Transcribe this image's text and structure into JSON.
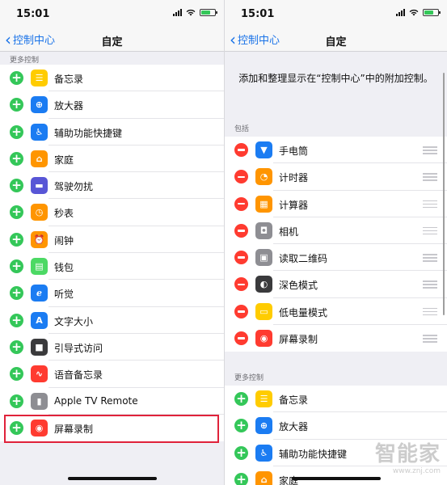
{
  "left": {
    "status": {
      "time": "15:01"
    },
    "nav": {
      "back": "控制中心",
      "title": "自定"
    },
    "section_more": "更多控制",
    "items": [
      {
        "label": "备忘录",
        "icon": "notes-icon",
        "color": "#ffcc00"
      },
      {
        "label": "放大器",
        "icon": "magnifier-icon",
        "color": "#1b7cf2"
      },
      {
        "label": "辅助功能快捷键",
        "icon": "accessibility-icon",
        "color": "#1b7cf2"
      },
      {
        "label": "家庭",
        "icon": "home-icon",
        "color": "#ff9500"
      },
      {
        "label": "驾驶勿扰",
        "icon": "car-icon",
        "color": "#5856d6"
      },
      {
        "label": "秒表",
        "icon": "stopwatch-icon",
        "color": "#ff9500"
      },
      {
        "label": "闹钟",
        "icon": "alarm-icon",
        "color": "#ff9500"
      },
      {
        "label": "钱包",
        "icon": "wallet-icon",
        "color": "#4cd964"
      },
      {
        "label": "听觉",
        "icon": "ear-icon",
        "color": "#1b7cf2"
      },
      {
        "label": "文字大小",
        "icon": "text-size-icon",
        "color": "#1b7cf2"
      },
      {
        "label": "引导式访问",
        "icon": "lock-icon",
        "color": "#3a3a3c"
      },
      {
        "label": "语音备忘录",
        "icon": "waveform-icon",
        "color": "#ff3b30"
      },
      {
        "label": "Apple TV Remote",
        "icon": "tv-remote-icon",
        "color": "#8e8e93"
      },
      {
        "label": "屏幕录制",
        "icon": "record-icon",
        "color": "#ff3b30"
      }
    ]
  },
  "right": {
    "status": {
      "time": "15:01"
    },
    "nav": {
      "back": "控制中心",
      "title": "自定"
    },
    "description": "添加和整理显示在“控制中心”中的附加控制。",
    "section_included": "包括",
    "included": [
      {
        "label": "手电筒",
        "icon": "flashlight-icon",
        "color": "#1b7cf2"
      },
      {
        "label": "计时器",
        "icon": "timer-icon",
        "color": "#ff9500"
      },
      {
        "label": "计算器",
        "icon": "calculator-icon",
        "color": "#ff9500"
      },
      {
        "label": "相机",
        "icon": "camera-icon",
        "color": "#8e8e93"
      },
      {
        "label": "读取二维码",
        "icon": "qr-code-icon",
        "color": "#8e8e93"
      },
      {
        "label": "深色模式",
        "icon": "dark-mode-icon",
        "color": "#3a3a3c"
      },
      {
        "label": "低电量模式",
        "icon": "battery-icon",
        "color": "#ffcc00"
      },
      {
        "label": "屏幕录制",
        "icon": "record-icon",
        "color": "#ff3b30"
      }
    ],
    "section_more": "更多控制",
    "more": [
      {
        "label": "备忘录",
        "icon": "notes-icon",
        "color": "#ffcc00"
      },
      {
        "label": "放大器",
        "icon": "magnifier-icon",
        "color": "#1b7cf2"
      },
      {
        "label": "辅助功能快捷键",
        "icon": "accessibility-icon",
        "color": "#1b7cf2"
      },
      {
        "label": "家庭",
        "icon": "home-icon",
        "color": "#ff9500"
      }
    ]
  },
  "watermark": {
    "logo": "智能家",
    "url": "www.znj.com"
  }
}
